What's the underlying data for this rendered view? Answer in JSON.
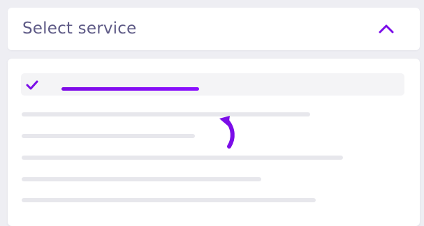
{
  "select": {
    "label": "Select service",
    "chevron_icon": "chevron-up-icon",
    "expanded": true
  },
  "dropdown": {
    "selected_icon": "check-icon",
    "options_visible": 6
  },
  "colors": {
    "accent": "#7b0de8",
    "label": "#5e5a86",
    "placeholder_line": "#e7e7ec",
    "selected_row_bg": "#f4f4f6",
    "background": "#eeeef3"
  },
  "annotation": {
    "icon": "curved-arrow-pointer-icon"
  }
}
